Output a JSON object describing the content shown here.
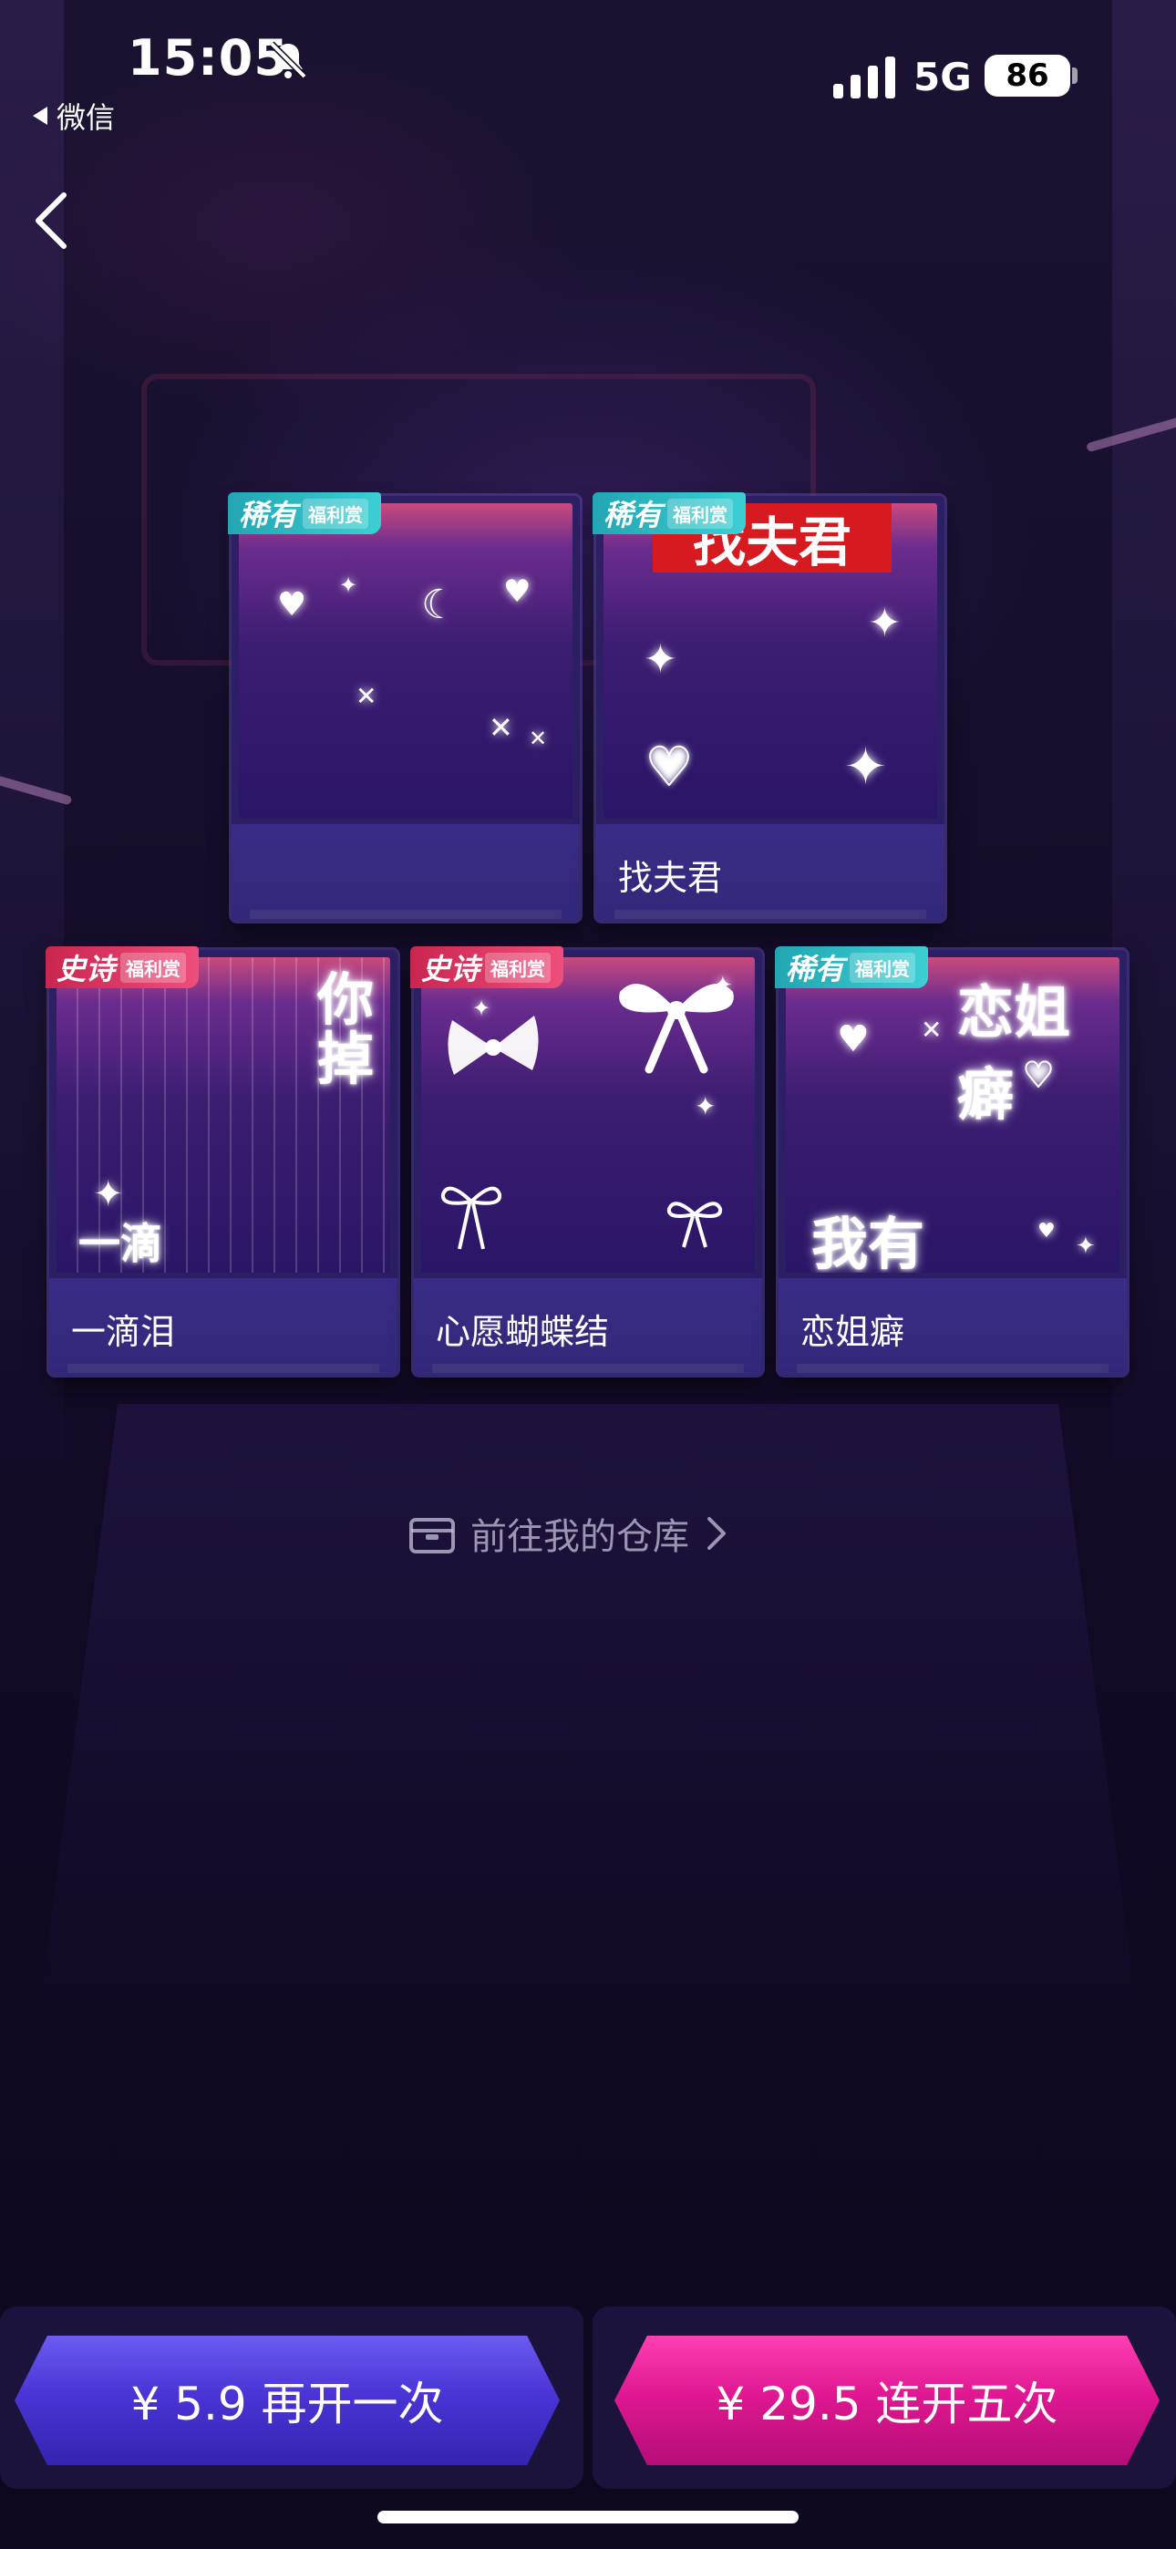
{
  "status_bar": {
    "time": "15:05",
    "back_app": "微信",
    "network": "5G",
    "battery": "86"
  },
  "nav": {
    "back_icon": "chevron-left-icon"
  },
  "cards": [
    {
      "badge_tier": "稀有",
      "badge_sub": "福利赏",
      "badge_type": "rare",
      "label": "",
      "art_text": ""
    },
    {
      "badge_tier": "稀有",
      "badge_sub": "福利赏",
      "badge_type": "rare",
      "label": "找夫君",
      "art_text": "找夫君"
    },
    {
      "badge_tier": "史诗",
      "badge_sub": "福利赏",
      "badge_type": "epic",
      "label": "一滴泪",
      "art_text": "你掉"
    },
    {
      "badge_tier": "史诗",
      "badge_sub": "福利赏",
      "badge_type": "epic",
      "label": "心愿蝴蝶结",
      "art_text": ""
    },
    {
      "badge_tier": "稀有",
      "badge_sub": "福利赏",
      "badge_type": "rare",
      "label": "恋姐癖",
      "art_text": "恋姐癖"
    }
  ],
  "card_art_extra": {
    "card3_bottom_text": "一滴",
    "card5_bottom_text": "我有"
  },
  "warehouse_link": {
    "label": "前往我的仓库",
    "icon": "box-icon"
  },
  "buttons": {
    "single": "¥ 5.9 再开一次",
    "five": "¥ 29.5 连开五次"
  },
  "colors": {
    "single_button": "#4a34d6",
    "five_button": "#e01891",
    "rare_badge": "#22a6b3",
    "epic_badge": "#c9264f"
  }
}
